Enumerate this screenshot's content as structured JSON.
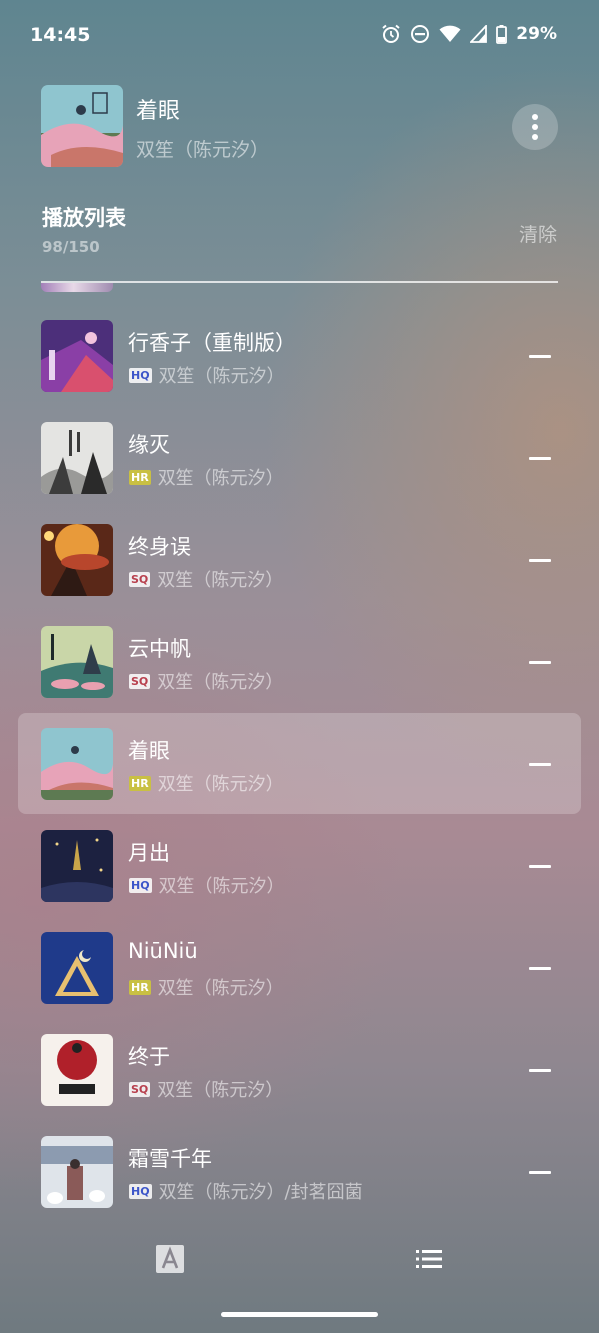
{
  "status_bar": {
    "time": "14:45",
    "battery": "29%"
  },
  "now_playing": {
    "title": "着眼",
    "artist": "双笙（陈元汐）"
  },
  "playlist": {
    "title": "播放列表",
    "count": "98/150",
    "clear_label": "清除"
  },
  "songs": [
    {
      "title": "行香子（重制版）",
      "quality": "HQ",
      "artist": "双笙（陈元汐）"
    },
    {
      "title": "缘灭",
      "quality": "HR",
      "artist": "双笙（陈元汐）"
    },
    {
      "title": "终身误",
      "quality": "SQ",
      "artist": "双笙（陈元汐）"
    },
    {
      "title": "云中帆",
      "quality": "SQ",
      "artist": "双笙（陈元汐）"
    },
    {
      "title": "着眼",
      "quality": "HR",
      "artist": "双笙（陈元汐）",
      "current": true
    },
    {
      "title": "月出",
      "quality": "HQ",
      "artist": "双笙（陈元汐）"
    },
    {
      "title": "NiūNiū",
      "quality": "HR",
      "artist": "双笙（陈元汐）"
    },
    {
      "title": "终于",
      "quality": "SQ",
      "artist": "双笙（陈元汐）"
    },
    {
      "title": "霜雪千年",
      "quality": "HQ",
      "artist": "双笙（陈元汐）/封茗囧菌"
    }
  ],
  "icons": {
    "alarm": "alarm-icon",
    "dnd": "do-not-disturb-icon",
    "wifi": "wifi-icon",
    "signal": "signal-icon",
    "battery": "battery-icon",
    "more": "more-vertical-icon",
    "remove": "minus-icon",
    "lyrics": "lyrics-icon",
    "playlist": "playlist-icon"
  },
  "colors": {
    "hq_badge": "#3d56c9",
    "hr_badge": "#c9c043",
    "sq_badge": "#b8404e"
  }
}
